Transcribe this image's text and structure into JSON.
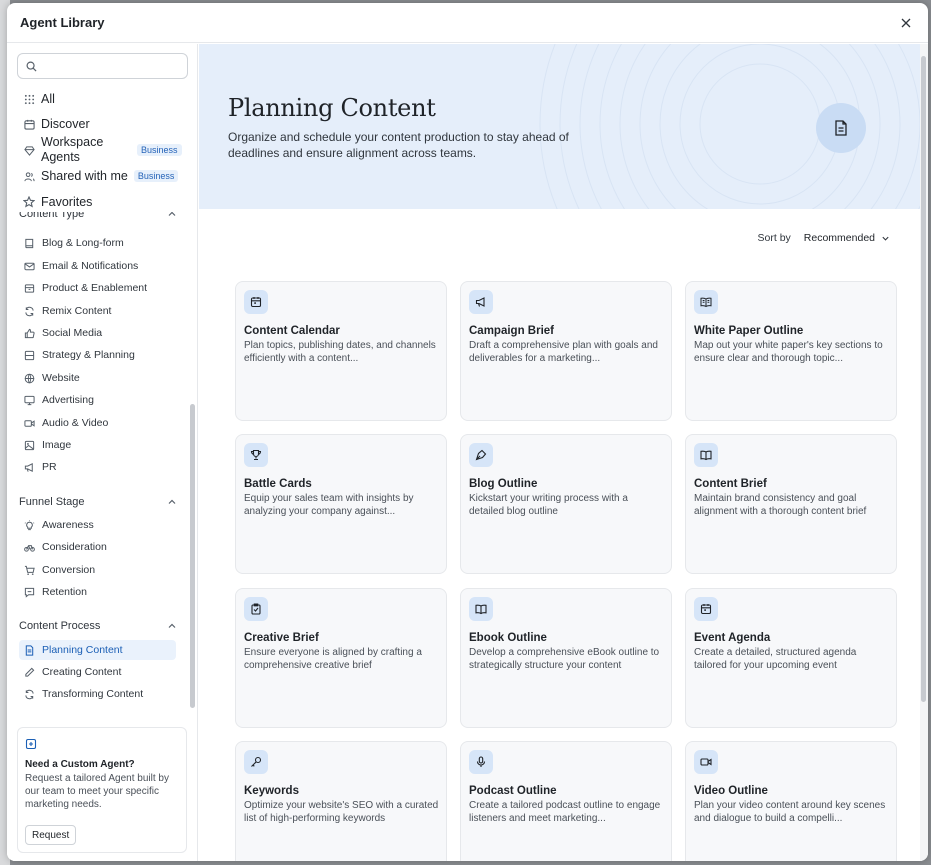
{
  "modal": {
    "title": "Agent Library"
  },
  "search": {
    "placeholder": "",
    "value": ""
  },
  "top_nav": [
    {
      "label": "All",
      "icon": "grid-icon"
    },
    {
      "label": "Discover",
      "icon": "calendar-icon"
    },
    {
      "label": "Workspace Agents",
      "icon": "gem-icon",
      "badge": "Business"
    },
    {
      "label": "Shared with me",
      "icon": "users-icon",
      "badge": "Business"
    },
    {
      "label": "Favorites",
      "icon": "star-icon"
    }
  ],
  "sections": {
    "content_type": {
      "title": "Content Type",
      "items": [
        {
          "label": "Blog & Long-form",
          "icon": "book-icon"
        },
        {
          "label": "Email & Notifications",
          "icon": "mail-icon"
        },
        {
          "label": "Product & Enablement",
          "icon": "box-icon"
        },
        {
          "label": "Remix Content",
          "icon": "refresh-icon"
        },
        {
          "label": "Social Media",
          "icon": "thumbs-up-icon"
        },
        {
          "label": "Strategy & Planning",
          "icon": "layers-icon"
        },
        {
          "label": "Website",
          "icon": "globe-icon"
        },
        {
          "label": "Advertising",
          "icon": "monitor-icon"
        },
        {
          "label": "Audio & Video",
          "icon": "video-icon"
        },
        {
          "label": "Image",
          "icon": "image-icon"
        },
        {
          "label": "PR",
          "icon": "megaphone-icon"
        }
      ]
    },
    "funnel_stage": {
      "title": "Funnel Stage",
      "items": [
        {
          "label": "Awareness",
          "icon": "lightbulb-icon"
        },
        {
          "label": "Consideration",
          "icon": "bike-icon"
        },
        {
          "label": "Conversion",
          "icon": "cart-icon"
        },
        {
          "label": "Retention",
          "icon": "message-icon"
        }
      ]
    },
    "content_process": {
      "title": "Content Process",
      "items": [
        {
          "label": "Planning Content",
          "icon": "document-icon",
          "active": true
        },
        {
          "label": "Creating Content",
          "icon": "pencil-icon"
        },
        {
          "label": "Transforming Content",
          "icon": "refresh-icon"
        }
      ]
    }
  },
  "custom_agent": {
    "title": "Need a Custom Agent?",
    "description": "Request a tailored Agent built by our team to meet your specific marketing needs.",
    "button": "Request"
  },
  "hero": {
    "title": "Planning Content",
    "description": "Organize and schedule your content production to stay ahead of deadlines and ensure alignment across teams."
  },
  "sort": {
    "label": "Sort by",
    "value": "Recommended"
  },
  "cards": [
    {
      "title": "Content Calendar",
      "desc": "Plan topics, publishing dates, and channels efficiently with a content...",
      "icon": "calendar-icon"
    },
    {
      "title": "Campaign Brief",
      "desc": "Draft a comprehensive plan with goals and deliverables for a marketing...",
      "icon": "megaphone-icon"
    },
    {
      "title": "White Paper Outline",
      "desc": "Map out your white paper's key sections to ensure clear and thorough topic...",
      "icon": "book-open-icon"
    },
    {
      "title": "Battle Cards",
      "desc": "Equip your sales team with insights by analyzing your company against...",
      "icon": "trophy-icon"
    },
    {
      "title": "Blog Outline",
      "desc": "Kickstart your writing process with a detailed blog outline",
      "icon": "pen-nib-icon"
    },
    {
      "title": "Content Brief",
      "desc": "Maintain brand consistency and goal alignment with a thorough content brief",
      "icon": "book-open-icon"
    },
    {
      "title": "Creative Brief",
      "desc": "Ensure everyone is aligned by crafting a comprehensive creative brief",
      "icon": "clipboard-check-icon"
    },
    {
      "title": "Ebook Outline",
      "desc": "Develop a comprehensive eBook outline to strategically structure your content",
      "icon": "book-open-icon"
    },
    {
      "title": "Event Agenda",
      "desc": "Create a detailed, structured agenda tailored for your upcoming event",
      "icon": "calendar-icon"
    },
    {
      "title": "Keywords",
      "desc": "Optimize your website's SEO with a curated list of high-performing keywords",
      "icon": "key-icon"
    },
    {
      "title": "Podcast Outline",
      "desc": "Create a tailored podcast outline to engage listeners and meet marketing...",
      "icon": "mic-icon"
    },
    {
      "title": "Video Outline",
      "desc": "Plan your video content around key scenes and dialogue to build a compelli...",
      "icon": "video-icon"
    }
  ],
  "colors": {
    "accent": "#1b5fb5",
    "hero_bg": "#e5eefa",
    "icon_bg": "#d6e5f8",
    "badge_bg": "#e7f0fb"
  }
}
